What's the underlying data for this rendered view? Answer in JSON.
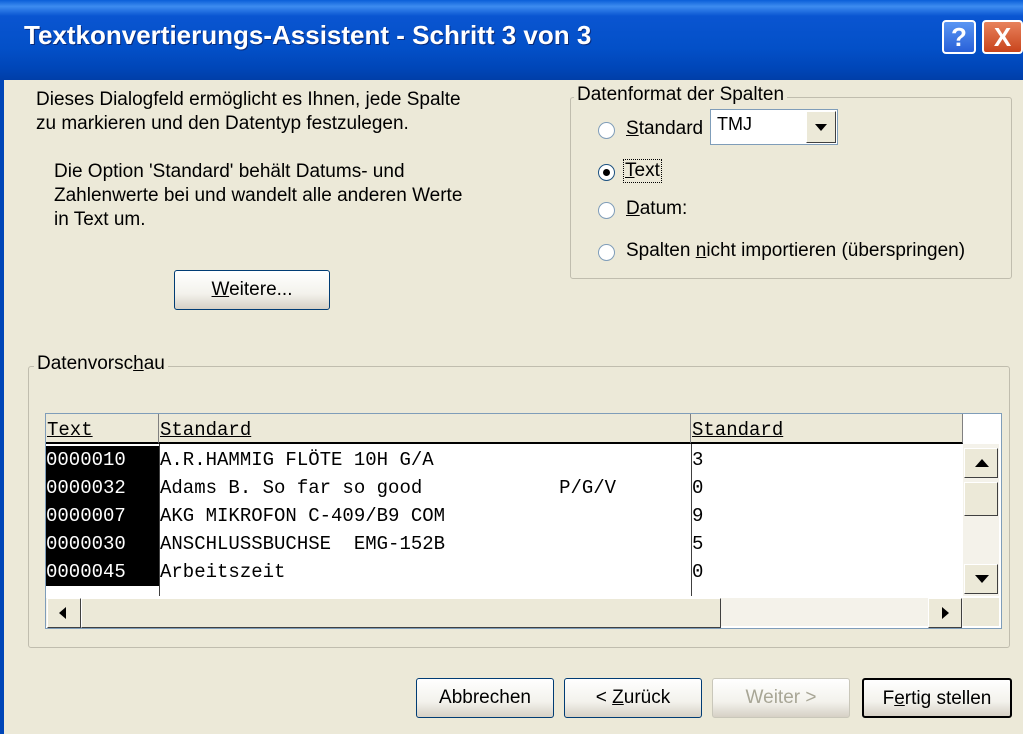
{
  "window": {
    "title": "Textkonvertierungs-Assistent - Schritt 3 von 3",
    "help_icon": "?",
    "close_icon": "X"
  },
  "description": {
    "line1": "Dieses Dialogfeld ermöglicht es Ihnen, jede Spalte",
    "line2": "zu markieren und den Datentyp festzulegen.",
    "line3": "Die Option 'Standard' behält Datums- und",
    "line4": "Zahlenwerte bei und wandelt alle anderen Werte",
    "line5": "in Text um."
  },
  "more_button": {
    "pre": "",
    "acc": "W",
    "post": "eitere..."
  },
  "format_group": {
    "title": "Datenformat der Spalten",
    "options": [
      {
        "pre": "",
        "acc": "S",
        "post": "tandard",
        "checked": false
      },
      {
        "pre": "",
        "acc": "T",
        "post": "ext",
        "checked": true
      },
      {
        "pre": "",
        "acc": "D",
        "post": "atum:",
        "checked": false
      },
      {
        "pre": "Spalten ",
        "acc": "n",
        "post": "icht importieren (überspringen)",
        "checked": false
      }
    ],
    "date_format": {
      "value": "TMJ"
    }
  },
  "preview_group": {
    "title_pre": "Datenvorsc",
    "title_acc": "h",
    "title_post": "au",
    "headers": [
      "Text",
      "Standard",
      "Standard"
    ],
    "rows": [
      [
        "0000010",
        "A.R.HAMMIG FLÖTE 10H G/A",
        "3"
      ],
      [
        "0000032",
        "Adams B. So far so good            P/G/V",
        "0"
      ],
      [
        "0000007",
        "AKG MIKROFON C-409/B9 COM",
        "9"
      ],
      [
        "0000030",
        "ANSCHLUSSBUCHSE  EMG-152B",
        "5"
      ],
      [
        "0000045",
        "Arbeitszeit",
        "0"
      ]
    ]
  },
  "buttons": {
    "cancel": "Abbrechen",
    "back": {
      "pre": "< ",
      "acc": "Z",
      "post": "urück"
    },
    "next": "Weiter >",
    "finish": {
      "pre": "F",
      "acc": "e",
      "post": "rtig stellen"
    }
  }
}
